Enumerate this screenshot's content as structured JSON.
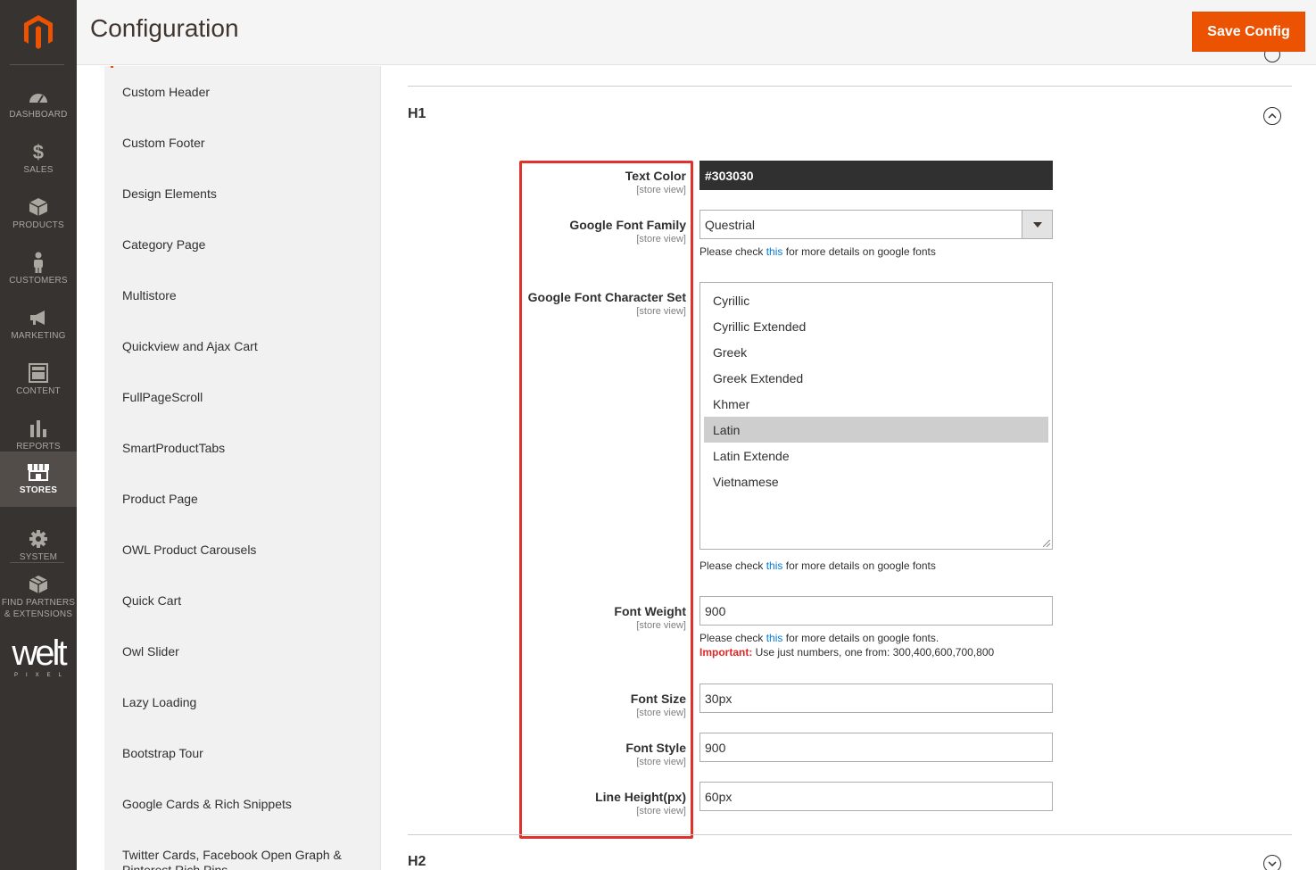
{
  "header": {
    "title": "Configuration",
    "save_label": "Save Config"
  },
  "menu": {
    "items": [
      {
        "label": "DASHBOARD",
        "icon": "gauge-icon"
      },
      {
        "label": "SALES",
        "icon": "dollar-icon"
      },
      {
        "label": "PRODUCTS",
        "icon": "cube-icon"
      },
      {
        "label": "CUSTOMERS",
        "icon": "person-icon"
      },
      {
        "label": "MARKETING",
        "icon": "megaphone-icon"
      },
      {
        "label": "CONTENT",
        "icon": "layout-icon"
      },
      {
        "label": "REPORTS",
        "icon": "bar-chart-icon"
      },
      {
        "label": "STORES",
        "icon": "storefront-icon"
      },
      {
        "label": "SYSTEM",
        "icon": "gear-icon"
      },
      {
        "label": "FIND PARTNERS\n& EXTENSIONS",
        "icon": "package-icon"
      }
    ],
    "active": "STORES",
    "brand_logo_text": "welt",
    "brand_logo_sub": "PIXEL"
  },
  "tabs": [
    "Custom Header",
    "Custom Footer",
    "Design Elements",
    "Category Page",
    "Multistore",
    "Quickview and Ajax Cart",
    "FullPageScroll",
    "SmartProductTabs",
    "Product Page",
    "OWL Product Carousels",
    "Quick Cart",
    "Owl Slider",
    "Lazy Loading",
    "Bootstrap Tour",
    "Google Cards & Rich Snippets",
    "Twitter Cards, Facebook Open Graph & Pinterest Rich Pins"
  ],
  "section_h1": {
    "title": "H1",
    "scope_label": "[store view]",
    "fields": {
      "text_color": {
        "label": "Text Color",
        "value": "#303030"
      },
      "font_family": {
        "label": "Google Font Family",
        "value": "Questrial"
      },
      "char_set": {
        "label": "Google Font Character Set",
        "options": [
          "Cyrillic",
          "Cyrillic Extended",
          "Greek",
          "Greek Extended",
          "Khmer",
          "Latin",
          "Latin Extende",
          "Vietnamese"
        ],
        "selected": "Latin"
      },
      "font_weight": {
        "label": "Font Weight",
        "value": "900"
      },
      "font_size": {
        "label": "Font Size",
        "value": "30px"
      },
      "font_style": {
        "label": "Font Style",
        "value": "900"
      },
      "line_height": {
        "label": "Line Height(px)",
        "value": "60px"
      }
    },
    "notes": {
      "prefix": "Please check ",
      "link": "this",
      "suffix_fonts": " for more details on google fonts",
      "suffix_fonts_dot": " for more details on google fonts.",
      "important_label": "Important:",
      "important_text": " Use just numbers, one from: 300,400,600,700,800"
    }
  },
  "section_h2": {
    "title": "H2"
  },
  "colors": {
    "accent": "#eb5202",
    "highlight": "#e0322a",
    "menu_bg": "#373330"
  }
}
